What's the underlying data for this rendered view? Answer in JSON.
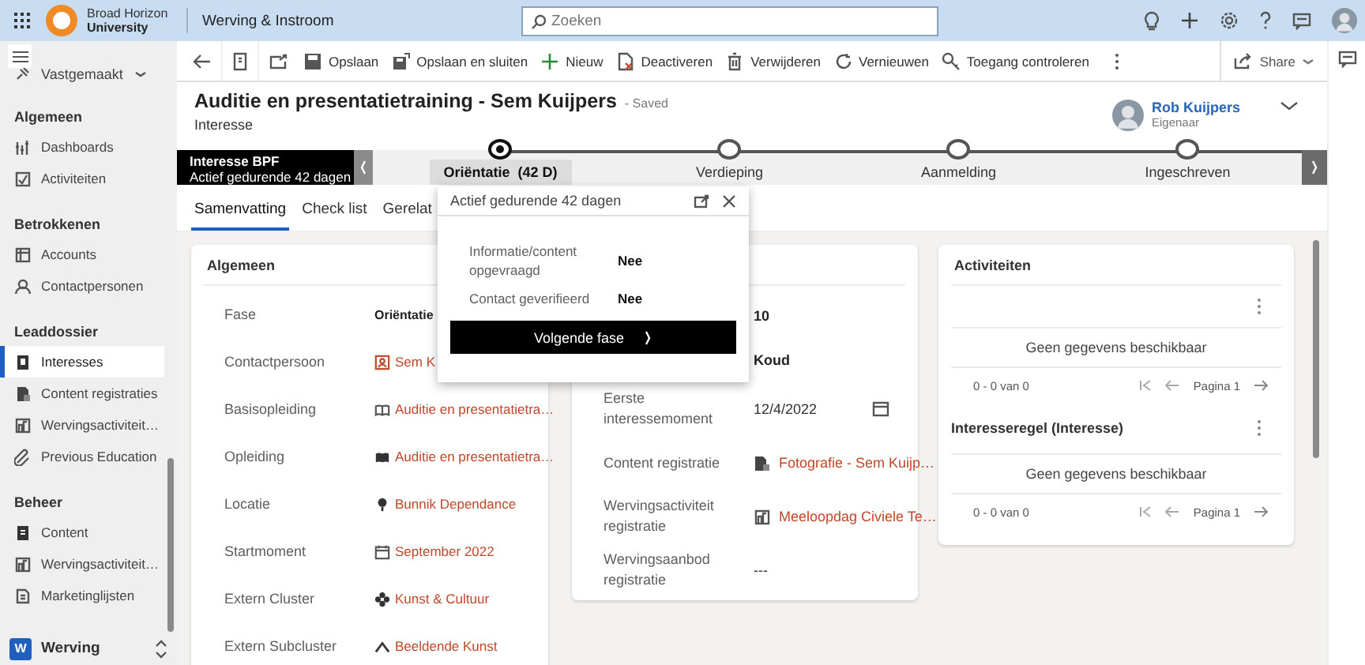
{
  "topbar": {
    "org_line1": "Broad Horizon",
    "org_line2": "University",
    "app_name": "Werving & Instroom",
    "search": {
      "placeholder": "Zoeken"
    }
  },
  "sidebar": {
    "pinned": "Vastgemaakt",
    "sections": [
      {
        "title": "Algemeen",
        "items": [
          {
            "label": "Dashboards",
            "selected": false
          },
          {
            "label": "Activiteiten",
            "selected": false
          }
        ]
      },
      {
        "title": "Betrokkenen",
        "items": [
          {
            "label": "Accounts",
            "selected": false
          },
          {
            "label": "Contactpersonen",
            "selected": false
          }
        ]
      },
      {
        "title": "Leaddossier",
        "items": [
          {
            "label": "Interesses",
            "selected": true
          },
          {
            "label": "Content registraties",
            "selected": false
          },
          {
            "label": "Wervingsactiviteit…",
            "selected": false
          },
          {
            "label": "Previous Education",
            "selected": false
          }
        ]
      },
      {
        "title": "Beheer",
        "items": [
          {
            "label": "Content",
            "selected": false
          },
          {
            "label": "Wervingsactiviteit…",
            "selected": false
          },
          {
            "label": "Marketinglijsten",
            "selected": false
          }
        ]
      }
    ],
    "area": {
      "badge": "W",
      "label": "Werving"
    }
  },
  "commands": [
    {
      "label": "Opslaan"
    },
    {
      "label": "Opslaan en sluiten"
    },
    {
      "label": "Nieuw"
    },
    {
      "label": "Deactiveren"
    },
    {
      "label": "Verwijderen"
    },
    {
      "label": "Vernieuwen"
    },
    {
      "label": "Toegang controleren"
    }
  ],
  "share": {
    "label": "Share"
  },
  "record": {
    "title": "Auditie en presentatietraining - Sem Kuijpers",
    "saved": "- Saved",
    "entity": "Interesse",
    "owner": {
      "name": "Rob Kuijpers",
      "role": "Eigenaar"
    }
  },
  "bpf": {
    "name": "Interesse BPF",
    "duration": "Actief gedurende 42 dagen",
    "stages": [
      {
        "label": "Oriëntatie  (42 D)",
        "selected": true
      },
      {
        "label": "Verdieping",
        "selected": false
      },
      {
        "label": "Aanmelding",
        "selected": false
      },
      {
        "label": "Ingeschreven",
        "selected": false
      }
    ]
  },
  "tabs": [
    {
      "label": "Samenvatting",
      "selected": true
    },
    {
      "label": "Check list",
      "selected": false
    },
    {
      "label": "Gerelat",
      "selected": false
    }
  ],
  "stage_popup": {
    "header": "Actief gedurende 42 dagen",
    "fields": [
      {
        "label": "Informatie/content opgevraagd",
        "value": "Nee"
      },
      {
        "label": "Contact geverifieerd",
        "value": "Nee"
      }
    ],
    "button": "Volgende fase"
  },
  "general": {
    "title": "Algemeen",
    "rows": [
      {
        "label": "Fase",
        "value": "Oriëntatie",
        "kind": "text"
      },
      {
        "label": "Contactpersoon",
        "value": "Sem K",
        "kind": "link"
      },
      {
        "label": "Basisopleiding",
        "value": "Auditie en presentatietra…",
        "kind": "link"
      },
      {
        "label": "Opleiding",
        "value": "Auditie en presentatietra…",
        "kind": "link"
      },
      {
        "label": "Locatie",
        "value": "Bunnik Dependance",
        "kind": "link"
      },
      {
        "label": "Startmoment",
        "value": "September 2022",
        "kind": "link"
      },
      {
        "label": "Extern Cluster",
        "value": "Kunst & Cultuur",
        "kind": "link"
      },
      {
        "label": "Extern Subcluster",
        "value": "Beeldende Kunst",
        "kind": "link"
      }
    ]
  },
  "details": {
    "rows": [
      {
        "value": "10",
        "kind": "text"
      },
      {
        "value": "Koud",
        "kind": "text"
      },
      {
        "label": "Eerste interessemoment",
        "value": "12/4/2022",
        "kind": "date"
      },
      {
        "label": "Content registratie",
        "value": "Fotografie - Sem Kuijp…",
        "kind": "link"
      },
      {
        "label": "Wervingsactiviteit registratie",
        "value": "Meeloopdag Civiele Te…",
        "kind": "link"
      },
      {
        "label": "Wervingsaanbod registratie",
        "value": "---",
        "kind": "empty"
      }
    ]
  },
  "subgrids": [
    {
      "title": "Activiteiten",
      "empty": "Geen gegevens beschikbaar",
      "count": "0 - 0 van 0",
      "page": "Pagina 1",
      "kind": "separate_menu"
    },
    {
      "title": "Interesseregel (Interesse)",
      "empty": "Geen gegevens beschikbaar",
      "count": "0 - 0 van 0",
      "page": "Pagina 1",
      "kind": "inline_menu"
    }
  ]
}
